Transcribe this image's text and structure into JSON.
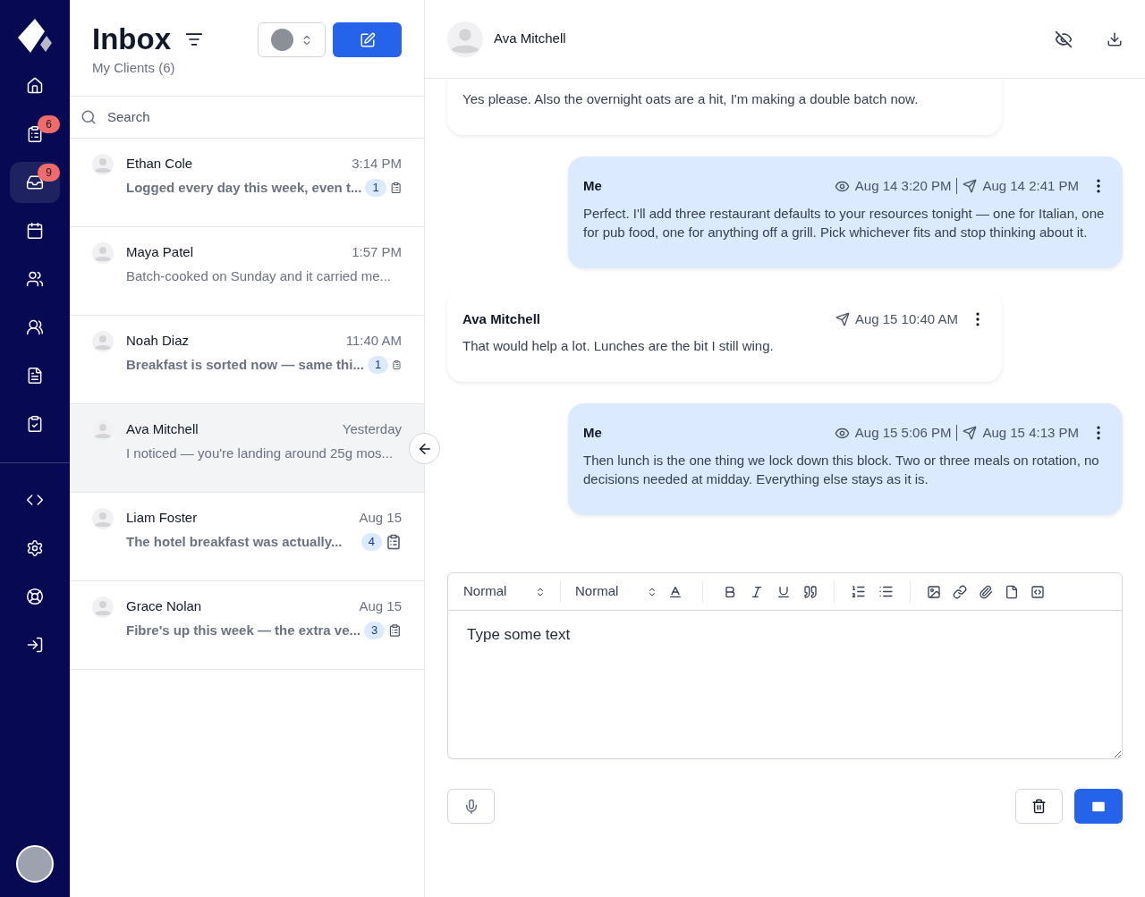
{
  "sidebar": {
    "items": [
      {
        "selected": false
      },
      {
        "badge": "6",
        "selected": false
      },
      {
        "badge": "9",
        "selected": true
      },
      {
        "selected": false
      },
      {
        "selected": false
      },
      {
        "selected": false
      },
      {
        "selected": false
      },
      {
        "selected": false
      }
    ]
  },
  "inbox": {
    "title": "Inbox",
    "subtitle": "My Clients (6)",
    "search": {
      "placeholder": "Search"
    },
    "conversations": [
      {
        "name": "Ethan Cole",
        "time": "3:14 PM",
        "preview": "Logged every day this week, even t...",
        "unread": true,
        "count": "1",
        "selected": false
      },
      {
        "name": "Maya Patel",
        "time": "1:57 PM",
        "preview": "Batch-cooked on Sunday and it carried me...",
        "unread": false,
        "selected": false
      },
      {
        "name": "Noah Diaz",
        "time": "11:40 AM",
        "preview": "Breakfast is sorted now — same thi...",
        "unread": true,
        "count": "1",
        "selected": false
      },
      {
        "name": "Ava Mitchell",
        "time": "Yesterday",
        "preview": "I noticed — you're landing around 25g mos...",
        "unread": false,
        "selected": true
      },
      {
        "name": "Liam Foster",
        "time": "Aug 15",
        "preview": "The hotel breakfast was actually...",
        "unread": true,
        "count": "4",
        "selected": false
      },
      {
        "name": "Grace Nolan",
        "time": "Aug 15",
        "preview": "Fibre's up this week — the extra ve...",
        "unread": true,
        "count": "3",
        "selected": false
      }
    ]
  },
  "chat": {
    "contact": "Ava Mitchell",
    "messages": [
      {
        "kind": "received",
        "cut": true,
        "text": "Yes please. Also the overnight oats are a hit, I'm making a double batch now."
      },
      {
        "kind": "sent",
        "sender": "Me",
        "seen": "Aug 14 3:20 PM",
        "sent": "Aug 14 2:41 PM",
        "text": "Perfect. I'll add three restaurant defaults to your resources tonight — one for Italian, one for pub food, one for anything off a grill. Pick whichever fits and stop thinking about it."
      },
      {
        "kind": "received",
        "sender": "Ava Mitchell",
        "sent": "Aug 15 10:40 AM",
        "text": "That would help a lot. Lunches are the bit I still wing."
      },
      {
        "kind": "sent",
        "sender": "Me",
        "seen": "Aug 15 5:06 PM",
        "sent": "Aug 15 4:13 PM",
        "text": "Then lunch is the one thing we lock down this block. Two or three meals on rotation, no decisions needed at midday. Everything else stays as it is."
      }
    ],
    "composer": {
      "header_style": "Normal",
      "font_size": "Normal",
      "placeholder": "Type some text"
    }
  }
}
